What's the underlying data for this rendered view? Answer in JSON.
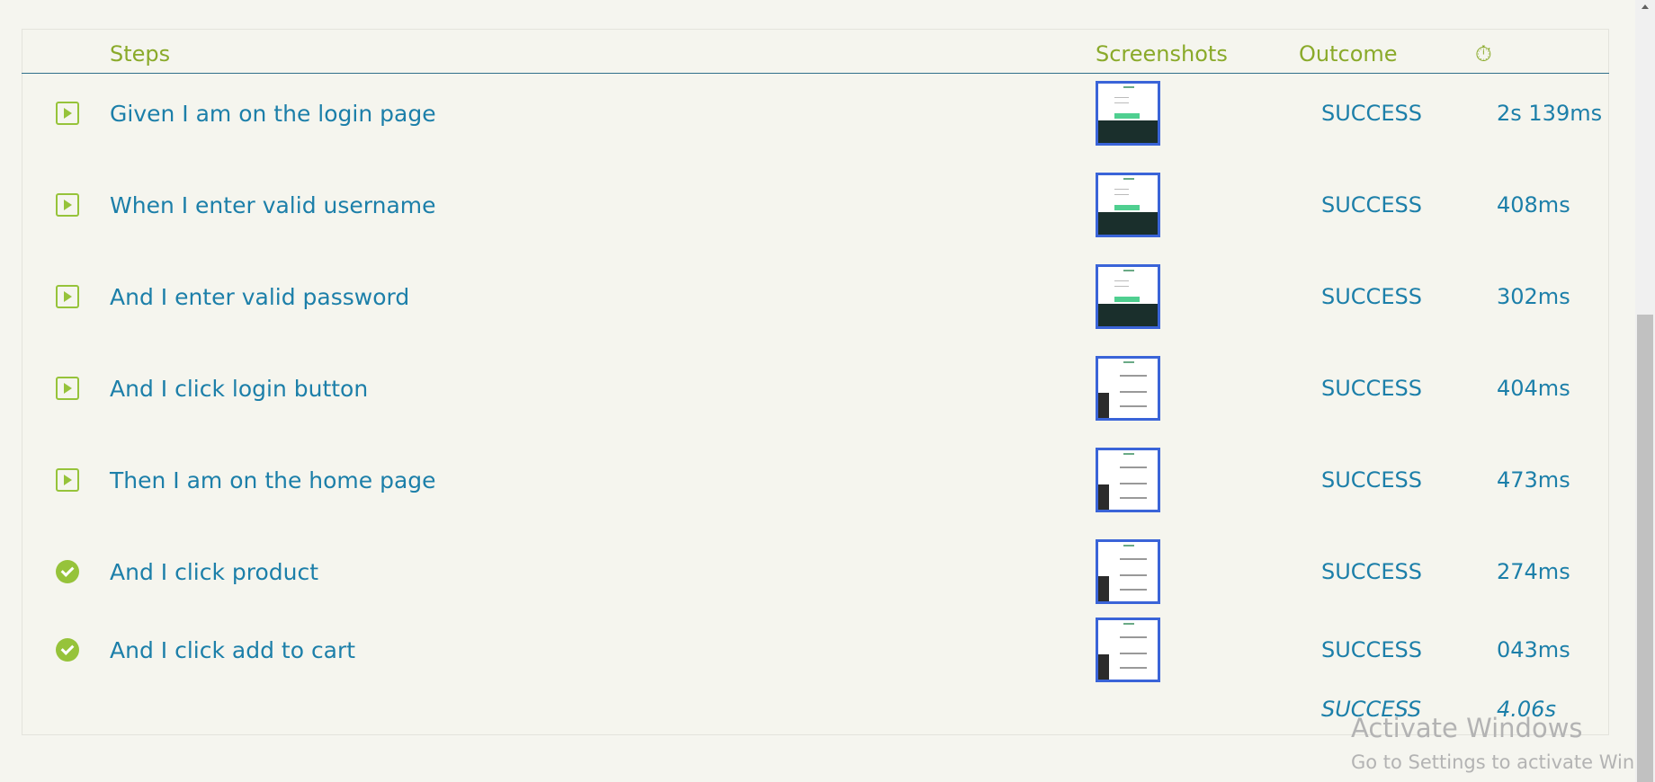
{
  "header": {
    "steps": "Steps",
    "screenshots": "Screenshots",
    "outcome": "Outcome",
    "duration_icon": "⏱"
  },
  "rows": [
    {
      "icon": "play-icon",
      "step": "Given I am on the login page",
      "outcome": "SUCCESS",
      "duration": "2s 139ms",
      "thumb": "login"
    },
    {
      "icon": "play-icon",
      "step": "When I enter valid username",
      "outcome": "SUCCESS",
      "duration": "408ms",
      "thumb": "login"
    },
    {
      "icon": "play-icon",
      "step": "And I enter valid password",
      "outcome": "SUCCESS",
      "duration": "302ms",
      "thumb": "login"
    },
    {
      "icon": "play-icon",
      "step": "And I click login button",
      "outcome": "SUCCESS",
      "duration": "404ms",
      "thumb": "shop"
    },
    {
      "icon": "play-icon",
      "step": "Then I am on the home page",
      "outcome": "SUCCESS",
      "duration": "473ms",
      "thumb": "shop"
    },
    {
      "icon": "check-circle-icon",
      "step": "And I click product",
      "outcome": "SUCCESS",
      "duration": "274ms",
      "thumb": "shop"
    },
    {
      "icon": "check-circle-icon",
      "step": "And I click add to cart",
      "outcome": "SUCCESS",
      "duration": "043ms",
      "thumb": "shop"
    }
  ],
  "summary": {
    "outcome": "SUCCESS",
    "duration": "4.06s"
  },
  "watermark": {
    "title": "Activate Windows",
    "subtitle": "Go to Settings to activate Windows."
  }
}
